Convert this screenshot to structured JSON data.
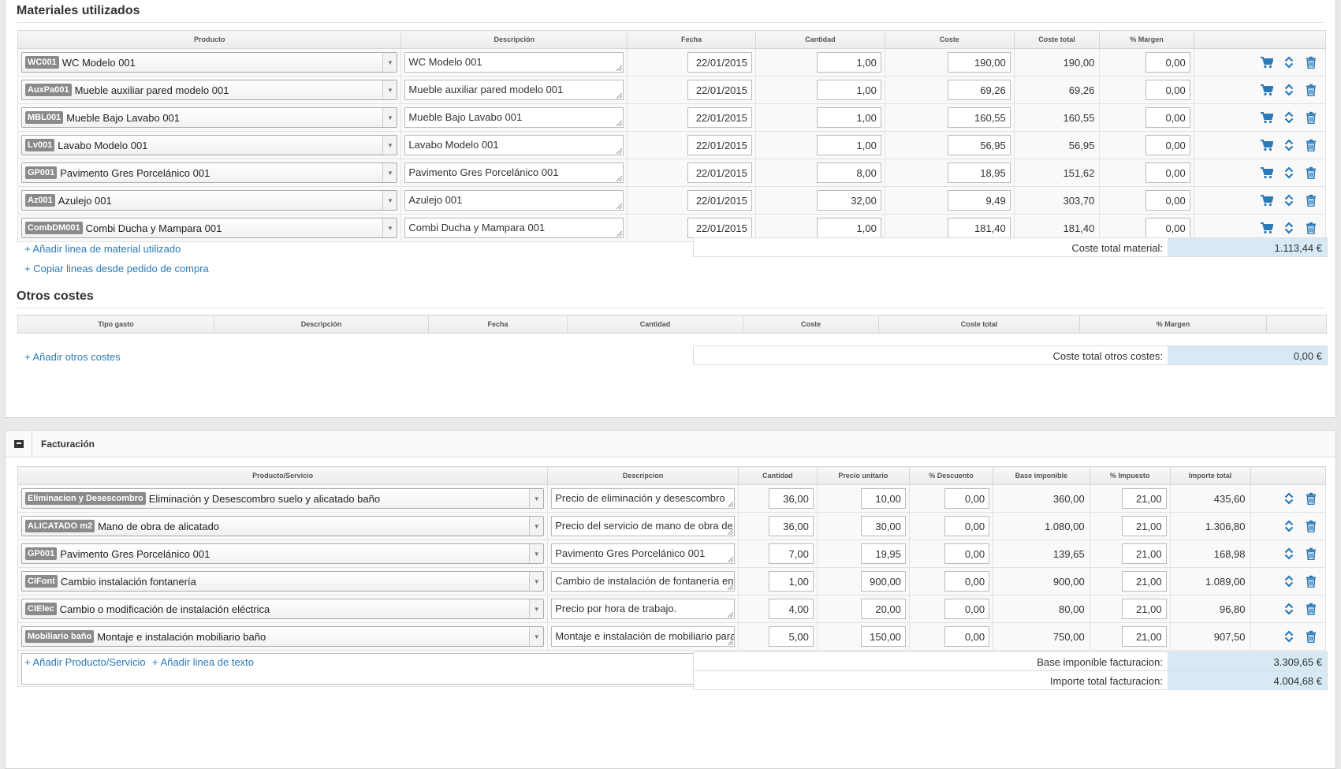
{
  "materiales": {
    "title": "Materiales utilizados",
    "headers": [
      "Producto",
      "Descripción",
      "Fecha",
      "Cantidad",
      "Coste",
      "Coste total",
      "% Margen",
      ""
    ],
    "rows": [
      {
        "code": "WC001",
        "name": "WC Modelo 001",
        "descripcion": "WC Modelo 001",
        "fecha": "22/01/2015",
        "cantidad": "1,00",
        "coste": "190,00",
        "coste_total": "190,00",
        "margen": "0,00"
      },
      {
        "code": "AuxPa001",
        "name": "Mueble auxiliar pared modelo 001",
        "descripcion": "Mueble auxiliar pared modelo 001",
        "fecha": "22/01/2015",
        "cantidad": "1,00",
        "coste": "69,26",
        "coste_total": "69,26",
        "margen": "0,00"
      },
      {
        "code": "MBL001",
        "name": "Mueble Bajo Lavabo 001",
        "descripcion": "Mueble Bajo Lavabo 001",
        "fecha": "22/01/2015",
        "cantidad": "1,00",
        "coste": "160,55",
        "coste_total": "160,55",
        "margen": "0,00"
      },
      {
        "code": "Lv001",
        "name": "Lavabo Modelo 001",
        "descripcion": "Lavabo Modelo 001",
        "fecha": "22/01/2015",
        "cantidad": "1,00",
        "coste": "56,95",
        "coste_total": "56,95",
        "margen": "0,00"
      },
      {
        "code": "GP001",
        "name": "Pavimento Gres Porcelánico 001",
        "descripcion": "Pavimento Gres Porcelánico 001",
        "fecha": "22/01/2015",
        "cantidad": "8,00",
        "coste": "18,95",
        "coste_total": "151,62",
        "margen": "0,00"
      },
      {
        "code": "Az001",
        "name": "Azulejo 001",
        "descripcion": "Azulejo 001",
        "fecha": "22/01/2015",
        "cantidad": "32,00",
        "coste": "9,49",
        "coste_total": "303,70",
        "margen": "0,00"
      },
      {
        "code": "CombDM001",
        "name": "Combi Ducha y Mampara 001",
        "descripcion": "Combi Ducha y Mampara 001",
        "fecha": "22/01/2015",
        "cantidad": "1,00",
        "coste": "181,40",
        "coste_total": "181,40",
        "margen": "0,00"
      }
    ],
    "add_link": "+ Añadir linea de material utilizado",
    "copy_link": "+ Copiar lineas desde pedido de compra",
    "total_label": "Coste total material:",
    "total_value": "1.113,44 €"
  },
  "otros": {
    "title": "Otros costes",
    "headers": [
      "Tipo gasto",
      "Descripción",
      "Fecha",
      "Cantidad",
      "Coste",
      "Coste total",
      "% Margen",
      ""
    ],
    "add_link": "+ Añadir otros costes",
    "total_label": "Coste total otros costes:",
    "total_value": "0,00 €"
  },
  "facturacion": {
    "title": "Facturación",
    "headers": [
      "Producto/Servicio",
      "Descripcion",
      "Cantidad",
      "Precio unitario",
      "% Descuento",
      "Base imponible",
      "% Impuesto",
      "Importe total",
      ""
    ],
    "rows": [
      {
        "code": "Eliminacion y Desescombro",
        "name": "Eliminación y Desescombro suelo y alicatado baño",
        "descripcion": "Precio de eliminación y desescombro",
        "cantidad": "36,00",
        "precio": "10,00",
        "descuento": "0,00",
        "base": "360,00",
        "impuesto": "21,00",
        "importe": "435,60"
      },
      {
        "code": "ALICATADO m2",
        "name": "Mano de obra de alicatado",
        "descripcion": "Precio del servicio de mano de obra de",
        "cantidad": "36,00",
        "precio": "30,00",
        "descuento": "0,00",
        "base": "1.080,00",
        "impuesto": "21,00",
        "importe": "1.306,80"
      },
      {
        "code": "GP001",
        "name": "Pavimento Gres Porcelánico 001",
        "descripcion": "Pavimento Gres Porcelánico 001",
        "cantidad": "7,00",
        "precio": "19,95",
        "descuento": "0,00",
        "base": "139,65",
        "impuesto": "21,00",
        "importe": "168,98"
      },
      {
        "code": "CIFont",
        "name": "Cambio instalación fontanería",
        "descripcion": "Cambio de instalación de fontanería en",
        "cantidad": "1,00",
        "precio": "900,00",
        "descuento": "0,00",
        "base": "900,00",
        "impuesto": "21,00",
        "importe": "1.089,00"
      },
      {
        "code": "CIElec",
        "name": "Cambio o modificación de instalación eléctrica",
        "descripcion": "Precio por hora de trabajo.",
        "cantidad": "4,00",
        "precio": "20,00",
        "descuento": "0,00",
        "base": "80,00",
        "impuesto": "21,00",
        "importe": "96,80"
      },
      {
        "code": "Mobiliario baño",
        "name": "Montaje e instalación mobiliario baño",
        "descripcion": "Montaje e instalación de mobiliario para",
        "cantidad": "5,00",
        "precio": "150,00",
        "descuento": "0,00",
        "base": "750,00",
        "impuesto": "21,00",
        "importe": "907,50"
      }
    ],
    "add_product_link": "+ Añadir Producto/Servicio",
    "add_text_link": "+ Añadir linea de texto",
    "base_label": "Base imponible facturacion:",
    "base_value": "3.309,65 €",
    "importe_label": "Importe total facturacion:",
    "importe_value": "4.004,68 €"
  },
  "colors": {
    "accent": "#2a7ab8",
    "total_bg": "#d6e9f5",
    "badge": "#8a8a8a"
  },
  "icons": {
    "cart": "cart-icon",
    "move": "move-updown-icon",
    "delete": "trash-icon",
    "collapse": "collapse-icon"
  }
}
